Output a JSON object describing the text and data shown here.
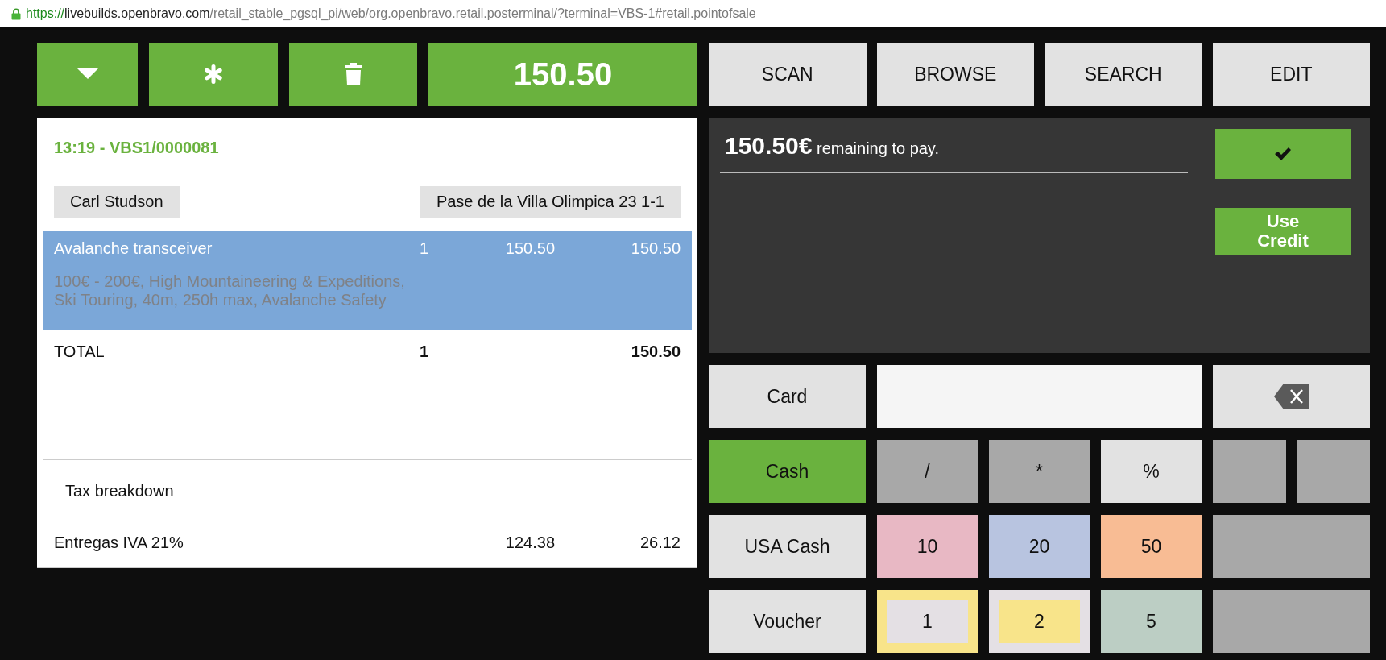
{
  "address_bar": {
    "scheme": "https://",
    "host": "livebuilds.openbravo.com",
    "path": "/retail_stable_pgsql_pi/web/org.openbravo.retail.posterminal/?terminal=VBS-1#retail.pointofsale"
  },
  "order_toolbar": [
    {
      "kind": "menu"
    },
    {
      "kind": "new"
    },
    {
      "kind": "delete"
    },
    {
      "kind": "total",
      "label": "150.50"
    }
  ],
  "receipt": {
    "header": "13:19 - VBS1/0000081",
    "customer": "Carl Studson",
    "address": "Pase de la Villa Olimpica 23 1-1",
    "lines": [
      {
        "product": "Avalanche transceiver",
        "description": "100€ - 200€, High Mountaineering & Expeditions, Ski Touring, 40m, 250h max, Avalanche Safety",
        "quantity": "1",
        "price": "150.50",
        "amount": "150.50",
        "selected": true
      }
    ],
    "total": {
      "label": "TOTAL",
      "quantity": "1",
      "amount": "150.50"
    },
    "tax_title": "Tax breakdown",
    "taxes": [
      {
        "name": "Entregas IVA 21%",
        "base": "124.38",
        "amount": "26.12"
      }
    ]
  },
  "tabs": [
    {
      "label": "SCAN"
    },
    {
      "label": "BROWSE"
    },
    {
      "label": "SEARCH"
    },
    {
      "label": "EDIT"
    }
  ],
  "payment": {
    "amount": "150.50€",
    "message": "remaining to pay.",
    "credit_button": "Use Credit"
  },
  "keypad": [
    [
      {
        "kind": "method",
        "label": "Card",
        "selected": false
      },
      {
        "kind": "input"
      },
      {
        "kind": "backspace"
      }
    ],
    [
      {
        "kind": "method",
        "label": "Cash",
        "selected": true
      },
      {
        "kind": "key",
        "label": "/",
        "color": "#a8a8a8"
      },
      {
        "kind": "key",
        "label": "*",
        "color": "#a8a8a8"
      },
      {
        "kind": "key",
        "label": "%",
        "color": "#e2e2e2"
      },
      {
        "kind": "blank"
      },
      {
        "kind": "blank"
      }
    ],
    [
      {
        "kind": "method",
        "label": "USA Cash",
        "selected": false
      },
      {
        "kind": "key",
        "label": "10",
        "color": "#e8b8c4"
      },
      {
        "kind": "key",
        "label": "20",
        "color": "#b8c4e0"
      },
      {
        "kind": "key",
        "label": "50",
        "color": "#f8bc94"
      },
      {
        "kind": "blank"
      }
    ],
    [
      {
        "kind": "method",
        "label": "Voucher",
        "selected": false
      },
      {
        "kind": "key",
        "label": "1",
        "color": "#f8e48a",
        "inner": {
          "color": "#e4e0e4"
        }
      },
      {
        "kind": "key",
        "label": "2",
        "color": "#e4e0e4",
        "inner": {
          "color": "#f8e48a"
        }
      },
      {
        "kind": "key",
        "label": "5",
        "color": "#bccec4"
      },
      {
        "kind": "blank"
      }
    ]
  ]
}
